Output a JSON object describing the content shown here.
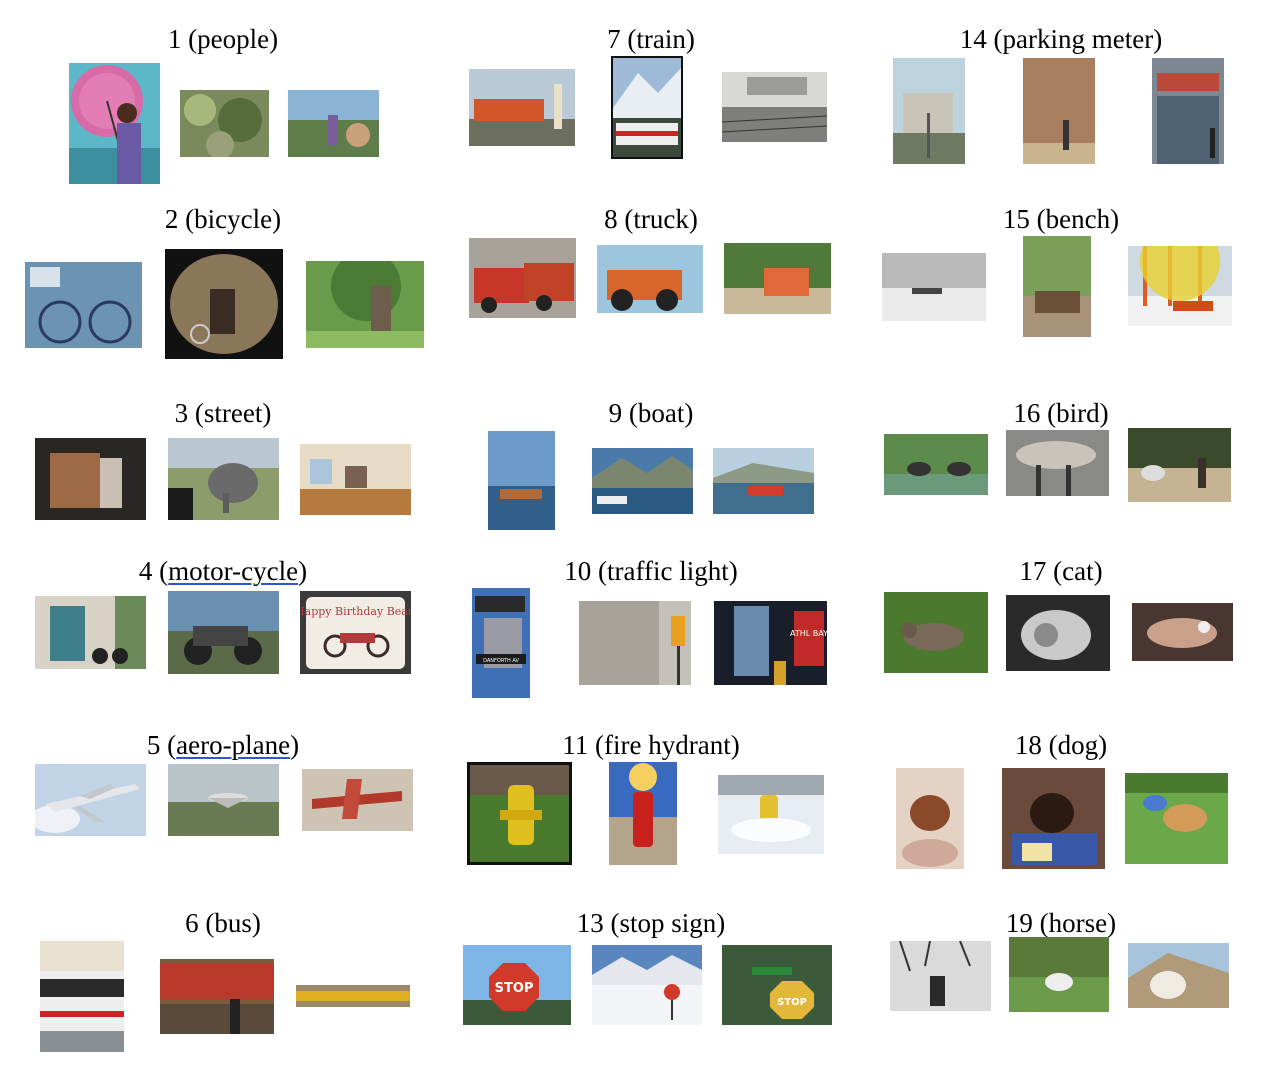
{
  "categories": [
    {
      "num": "1",
      "name": "people"
    },
    {
      "num": "2",
      "name": "bicycle"
    },
    {
      "num": "3",
      "name": "street"
    },
    {
      "num": "4",
      "name": "motor-cycle"
    },
    {
      "num": "5",
      "name": "aero-plane"
    },
    {
      "num": "6",
      "name": "bus"
    },
    {
      "num": "7",
      "name": "train"
    },
    {
      "num": "8",
      "name": "truck"
    },
    {
      "num": "9",
      "name": "boat"
    },
    {
      "num": "10",
      "name": "traffic light"
    },
    {
      "num": "11",
      "name": "fire hydrant"
    },
    {
      "num": "13",
      "name": "stop sign"
    },
    {
      "num": "14",
      "name": "parking meter"
    },
    {
      "num": "15",
      "name": "bench"
    },
    {
      "num": "16",
      "name": "bird"
    },
    {
      "num": "17",
      "name": "cat"
    },
    {
      "num": "18",
      "name": "dog"
    },
    {
      "num": "19",
      "name": "horse"
    }
  ],
  "photo_texts": {
    "birthday_cake": "Happy Birthday Beau",
    "street_sign": "DANFORTH AV",
    "billboard": "ATHL BAY",
    "stop_word": "STOP"
  }
}
